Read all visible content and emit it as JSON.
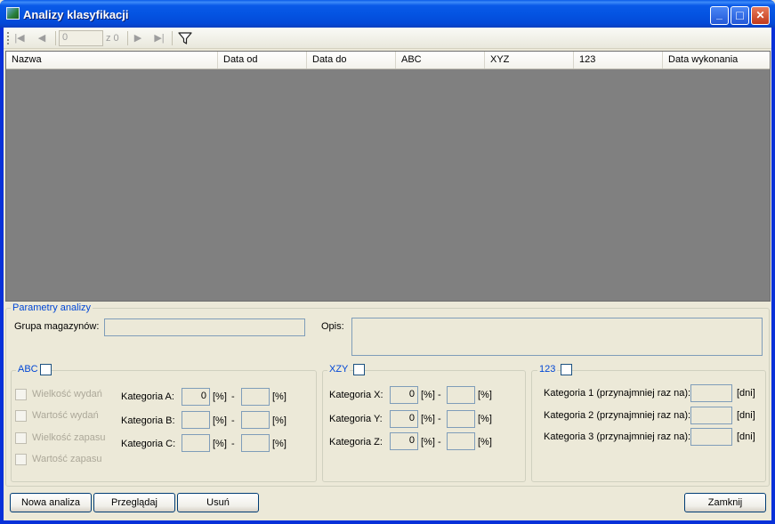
{
  "window": {
    "title": "Analizy klasyfikacji",
    "icon": "chart-app-icon"
  },
  "titlebar_buttons": {
    "minimize": "_",
    "maximize": "□",
    "close": "✕"
  },
  "toolbar": {
    "nav_first": "|◀",
    "nav_prev": "◀",
    "nav_next": "▶",
    "nav_last": "▶|",
    "position_value": "0",
    "count_label": "z 0",
    "filter_icon": "filter-icon"
  },
  "grid": {
    "columns": [
      "Nazwa",
      "Data od",
      "Data do",
      "ABC",
      "XYZ",
      "123",
      "Data wykonania"
    ]
  },
  "params": {
    "legend": "Parametry analizy",
    "group_label": "Grupa magazynów:",
    "group_value": "",
    "desc_label": "Opis:",
    "desc_value": ""
  },
  "abc": {
    "legend": "ABC",
    "options": [
      "Wielkość wydań",
      "Wartość wydań",
      "Wielkość zapasu",
      "Wartość zapasu"
    ],
    "categories": [
      {
        "label": "Kategoria A:",
        "from": "0",
        "to": ""
      },
      {
        "label": "Kategoria B:",
        "from": "",
        "to": ""
      },
      {
        "label": "Kategoria C:",
        "from": "",
        "to": ""
      }
    ],
    "unit": "[%]",
    "dash": "-"
  },
  "xzy": {
    "legend": "XZY",
    "categories": [
      {
        "label": "Kategoria X:",
        "from": "0",
        "to": ""
      },
      {
        "label": "Kategoria Y:",
        "from": "0",
        "to": ""
      },
      {
        "label": "Kategoria Z:",
        "from": "0",
        "to": ""
      }
    ],
    "unit": "[%]",
    "dash": "-"
  },
  "k123": {
    "legend": "123",
    "categories": [
      {
        "label": "Kategoria 1 (przynajmniej raz na):",
        "value": ""
      },
      {
        "label": "Kategoria 2 (przynajmniej raz na):",
        "value": ""
      },
      {
        "label": "Kategoria 3 (przynajmniej raz na):",
        "value": ""
      }
    ],
    "unit": "[dni]"
  },
  "buttons": {
    "new": "Nowa analiza",
    "browse": "Przeglądaj",
    "delete": "Usuń",
    "close": "Zamknij"
  }
}
